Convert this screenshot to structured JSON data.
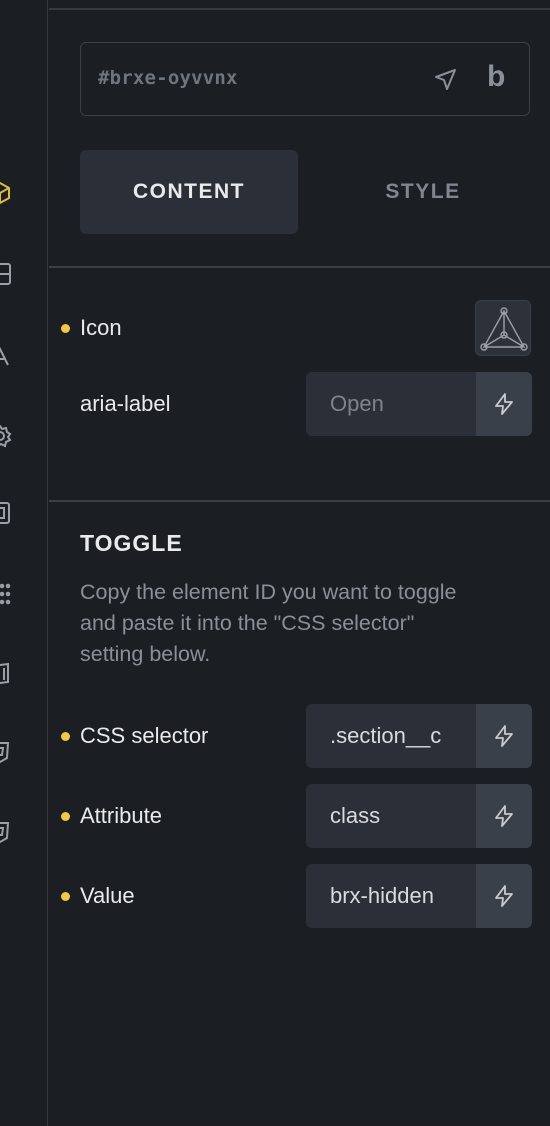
{
  "element_id": {
    "value": "#brxe-oyvvnx",
    "logo_text": "b"
  },
  "tabs": [
    {
      "label": "CONTENT",
      "active": true
    },
    {
      "label": "STYLE",
      "active": false
    }
  ],
  "fields": {
    "icon": {
      "label": "Icon",
      "value_icon": "network-graph-icon"
    },
    "aria_label": {
      "label": "aria-label",
      "placeholder": "Open"
    }
  },
  "toggle_section": {
    "heading": "TOGGLE",
    "description": "Copy the element ID you want to toggle and paste it into the \"CSS selector\" setting below.",
    "css_selector": {
      "label": "CSS selector",
      "value": ".section__c"
    },
    "attribute": {
      "label": "Attribute",
      "value": "class"
    },
    "value": {
      "label": "Value",
      "value": "brx-hidden"
    }
  },
  "colors": {
    "background": "#1b1e22",
    "input_bg": "#2b3038",
    "indicator_dot": "#f2c744",
    "accent_icon": "#e0b93e"
  },
  "rail_icons": [
    "cube-icon",
    "layout-icon",
    "typography-icon",
    "gear-icon",
    "box-icon",
    "list-icon",
    "book-icon",
    "shield-icon",
    "shield-icon"
  ]
}
